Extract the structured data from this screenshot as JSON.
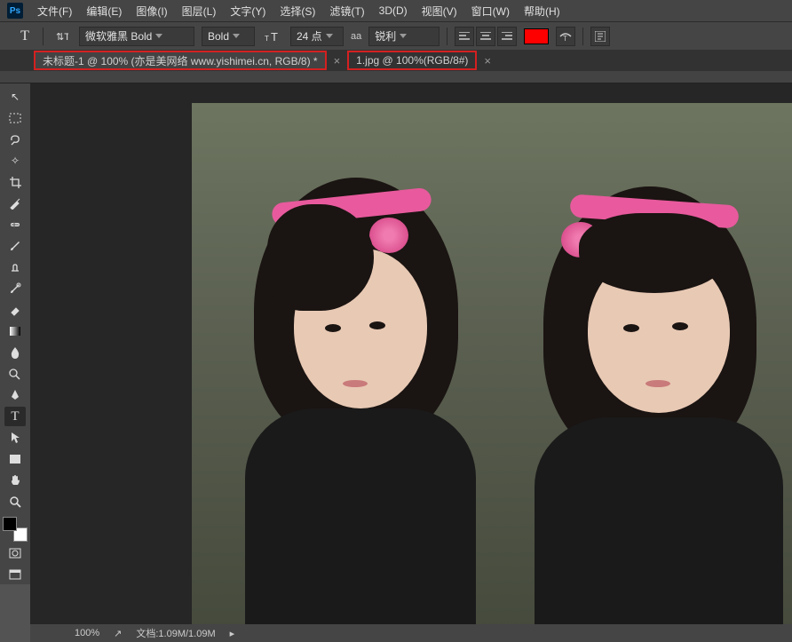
{
  "menu": {
    "items": [
      "文件(F)",
      "编辑(E)",
      "图像(I)",
      "图层(L)",
      "文字(Y)",
      "选择(S)",
      "滤镜(T)",
      "3D(D)",
      "视图(V)",
      "窗口(W)",
      "帮助(H)"
    ]
  },
  "options": {
    "font_family": "微软雅黑 Bold",
    "font_weight": "Bold",
    "font_size": "24 点",
    "aa_label": "aa",
    "antialias": "锐利",
    "color": "#ff0000"
  },
  "tabs": [
    {
      "label": "未标题-1 @ 100% (亦是美网络 www.yishimei.cn, RGB/8) *",
      "active": true
    },
    {
      "label": "1.jpg @ 100%(RGB/8#)",
      "active": false
    }
  ],
  "tools": [
    {
      "name": "move-tool",
      "glyph": "↖"
    },
    {
      "name": "marquee-tool",
      "glyph": "▭"
    },
    {
      "name": "lasso-tool",
      "glyph": "⌇"
    },
    {
      "name": "magic-wand-tool",
      "glyph": "✦"
    },
    {
      "name": "crop-tool",
      "glyph": "⊡"
    },
    {
      "name": "eyedropper-tool",
      "glyph": "✎"
    },
    {
      "name": "healing-brush-tool",
      "glyph": "◍"
    },
    {
      "name": "brush-tool",
      "glyph": "✐"
    },
    {
      "name": "clone-stamp-tool",
      "glyph": "⊕"
    },
    {
      "name": "history-brush-tool",
      "glyph": "↺"
    },
    {
      "name": "eraser-tool",
      "glyph": "◧"
    },
    {
      "name": "gradient-tool",
      "glyph": "▦"
    },
    {
      "name": "blur-tool",
      "glyph": "○"
    },
    {
      "name": "dodge-tool",
      "glyph": "◐"
    },
    {
      "name": "pen-tool",
      "glyph": "✒"
    },
    {
      "name": "type-tool",
      "glyph": "T",
      "active": true
    },
    {
      "name": "path-select-tool",
      "glyph": "↗"
    },
    {
      "name": "rectangle-tool",
      "glyph": "▢"
    },
    {
      "name": "hand-tool",
      "glyph": "✋"
    },
    {
      "name": "zoom-tool",
      "glyph": "🔍"
    }
  ],
  "status": {
    "zoom": "100%",
    "doc_size": "文档:1.09M/1.09M"
  }
}
